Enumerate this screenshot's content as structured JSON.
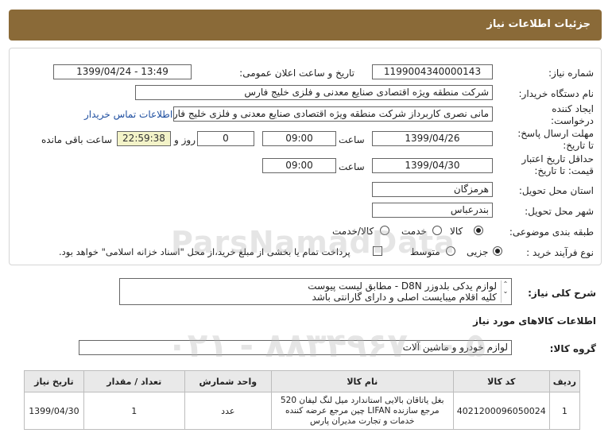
{
  "header": {
    "title": "جزئیات اطلاعات نیاز"
  },
  "form": {
    "need_number_label": "شماره نیاز:",
    "need_number": "1199004340000143",
    "announce_label": "تاریخ و ساعت اعلان عمومی:",
    "announce_value": "1399/04/24 - 13:49",
    "buyer_label": "نام دستگاه خریدار:",
    "buyer_value": "شرکت منطقه ویژه اقتصادی صنایع معدنی و فلزی خلیج فارس",
    "creator_label": "ایجاد کننده درخواست:",
    "creator_value": "مانی نصری کاربرداز شرکت منطقه ویژه اقتصادی صنایع معدنی و فلزی خلیج فارس",
    "contact_link": "اطلاعات تماس خریدار",
    "deadline_label": "مهلت ارسال پاسخ: تا تاریخ:",
    "deadline_date": "1399/04/26",
    "time_label": "ساعت",
    "deadline_time": "09:00",
    "days_value": "0",
    "days_label": "روز و",
    "remaining_time": "22:59:38",
    "remaining_label": "ساعت باقی مانده",
    "validity_label": "حداقل تاریخ اعتبار قیمت: تا تاریخ:",
    "validity_date": "1399/04/30",
    "validity_time": "09:00",
    "province_label": "استان محل تحویل:",
    "province_value": "هرمزگان",
    "city_label": "شهر محل تحویل:",
    "city_value": "بندرعباس",
    "category_label": "طبقه بندی موضوعی:",
    "category_options": [
      "کالا",
      "خدمت",
      "کالا/خدمت"
    ],
    "category_selected": "کالا",
    "process_label": "نوع فرآیند خرید :",
    "process_options": [
      "جزیی",
      "متوسط"
    ],
    "process_selected": "جزیی",
    "payment_note": "پرداخت تمام یا بخشی از مبلغ خرید،از محل \"اسناد خزانه اسلامی\" خواهد بود."
  },
  "description": {
    "label": "شرح کلی نیاز:",
    "line1": "لوازم یدکی بلدوزر D8N - مطابق لیست پیوست",
    "line2": "کلیه اقلام میبایست اصلی و دارای گارانتی باشد"
  },
  "goods": {
    "section_title": "اطلاعات کالاهای مورد نیاز",
    "group_label": "گروه کالا:",
    "group_value": "لوازم خودرو و ماشین آلات",
    "columns": [
      "ردیف",
      "کد کالا",
      "نام کالا",
      "واحد شمارش",
      "تعداد / مقدار",
      "تاریخ نیاز"
    ],
    "rows": [
      {
        "index": "1",
        "code": "4021200096050024",
        "name": "بغل یاتاقان بالایی استاندارد میل لنگ لیفان 520 مرجع سازنده LIFAN چین مرجع عرضه کننده خدمات و تجارت مدیران پارس",
        "unit": "عدد",
        "qty": "1",
        "date": "1399/04/30"
      }
    ]
  },
  "watermark": {
    "brand": "ParsNamadData",
    "phone": "۰۲۱ - ۸۸۳۴۹۶۷۰ - ۵"
  }
}
